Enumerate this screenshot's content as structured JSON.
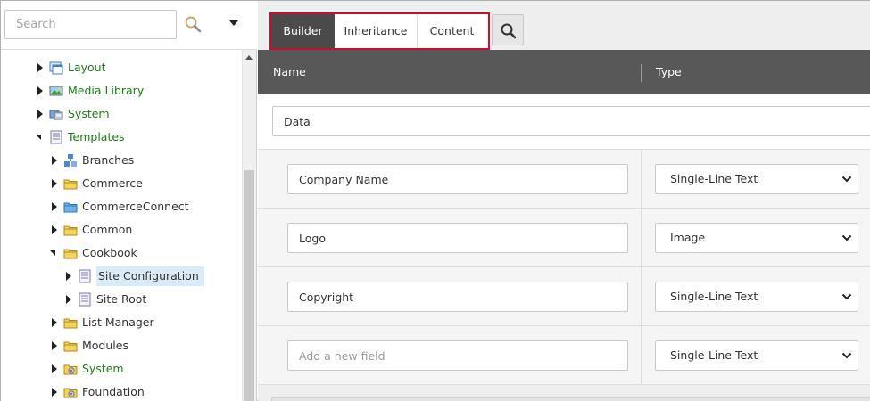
{
  "search": {
    "placeholder": "Search"
  },
  "tree": [
    {
      "label": "Layout",
      "color": "green",
      "icon": "layout-icon",
      "state": "collapsed"
    },
    {
      "label": "Media Library",
      "color": "green",
      "icon": "media-library-icon",
      "state": "collapsed"
    },
    {
      "label": "System",
      "color": "green",
      "icon": "system-icon",
      "state": "collapsed"
    },
    {
      "label": "Templates",
      "color": "green",
      "icon": "templates-icon",
      "state": "expanded"
    },
    {
      "label": "Branches",
      "color": "dark",
      "icon": "branches-icon",
      "state": "collapsed"
    },
    {
      "label": "Commerce",
      "color": "dark",
      "icon": "folder-icon",
      "state": "collapsed"
    },
    {
      "label": "CommerceConnect",
      "color": "dark",
      "icon": "folder-blue-icon",
      "state": "collapsed"
    },
    {
      "label": "Common",
      "color": "dark",
      "icon": "folder-icon",
      "state": "collapsed"
    },
    {
      "label": "Cookbook",
      "color": "dark",
      "icon": "folder-icon",
      "state": "expanded"
    },
    {
      "label": "Site Configuration",
      "color": "dark",
      "icon": "template-icon",
      "state": "collapsed",
      "selected": true
    },
    {
      "label": "Site Root",
      "color": "dark",
      "icon": "template-icon",
      "state": "collapsed"
    },
    {
      "label": "List Manager",
      "color": "dark",
      "icon": "folder-icon",
      "state": "collapsed"
    },
    {
      "label": "Modules",
      "color": "dark",
      "icon": "folder-icon",
      "state": "collapsed"
    },
    {
      "label": "System",
      "color": "green",
      "icon": "system-folder-icon",
      "state": "collapsed"
    },
    {
      "label": "Foundation",
      "color": "dark",
      "icon": "system-folder-icon",
      "state": "collapsed"
    }
  ],
  "tabs": [
    {
      "label": "Builder",
      "active": true
    },
    {
      "label": "Inheritance",
      "active": false
    },
    {
      "label": "Content",
      "active": false
    }
  ],
  "table": {
    "col_name": "Name",
    "col_type": "Type",
    "section": "Data",
    "fields": [
      {
        "name": "Company Name",
        "type": "Single-Line Text"
      },
      {
        "name": "Logo",
        "type": "Image"
      },
      {
        "name": "Copyright",
        "type": "Single-Line Text"
      }
    ],
    "new_field": {
      "placeholder": "Add a new field",
      "type": "Single-Line Text"
    }
  },
  "colors": {
    "tab_highlight": "#c8102e",
    "header_bg": "#585858",
    "tree_green": "#1a7d14",
    "selection": "#d8ebf7"
  }
}
